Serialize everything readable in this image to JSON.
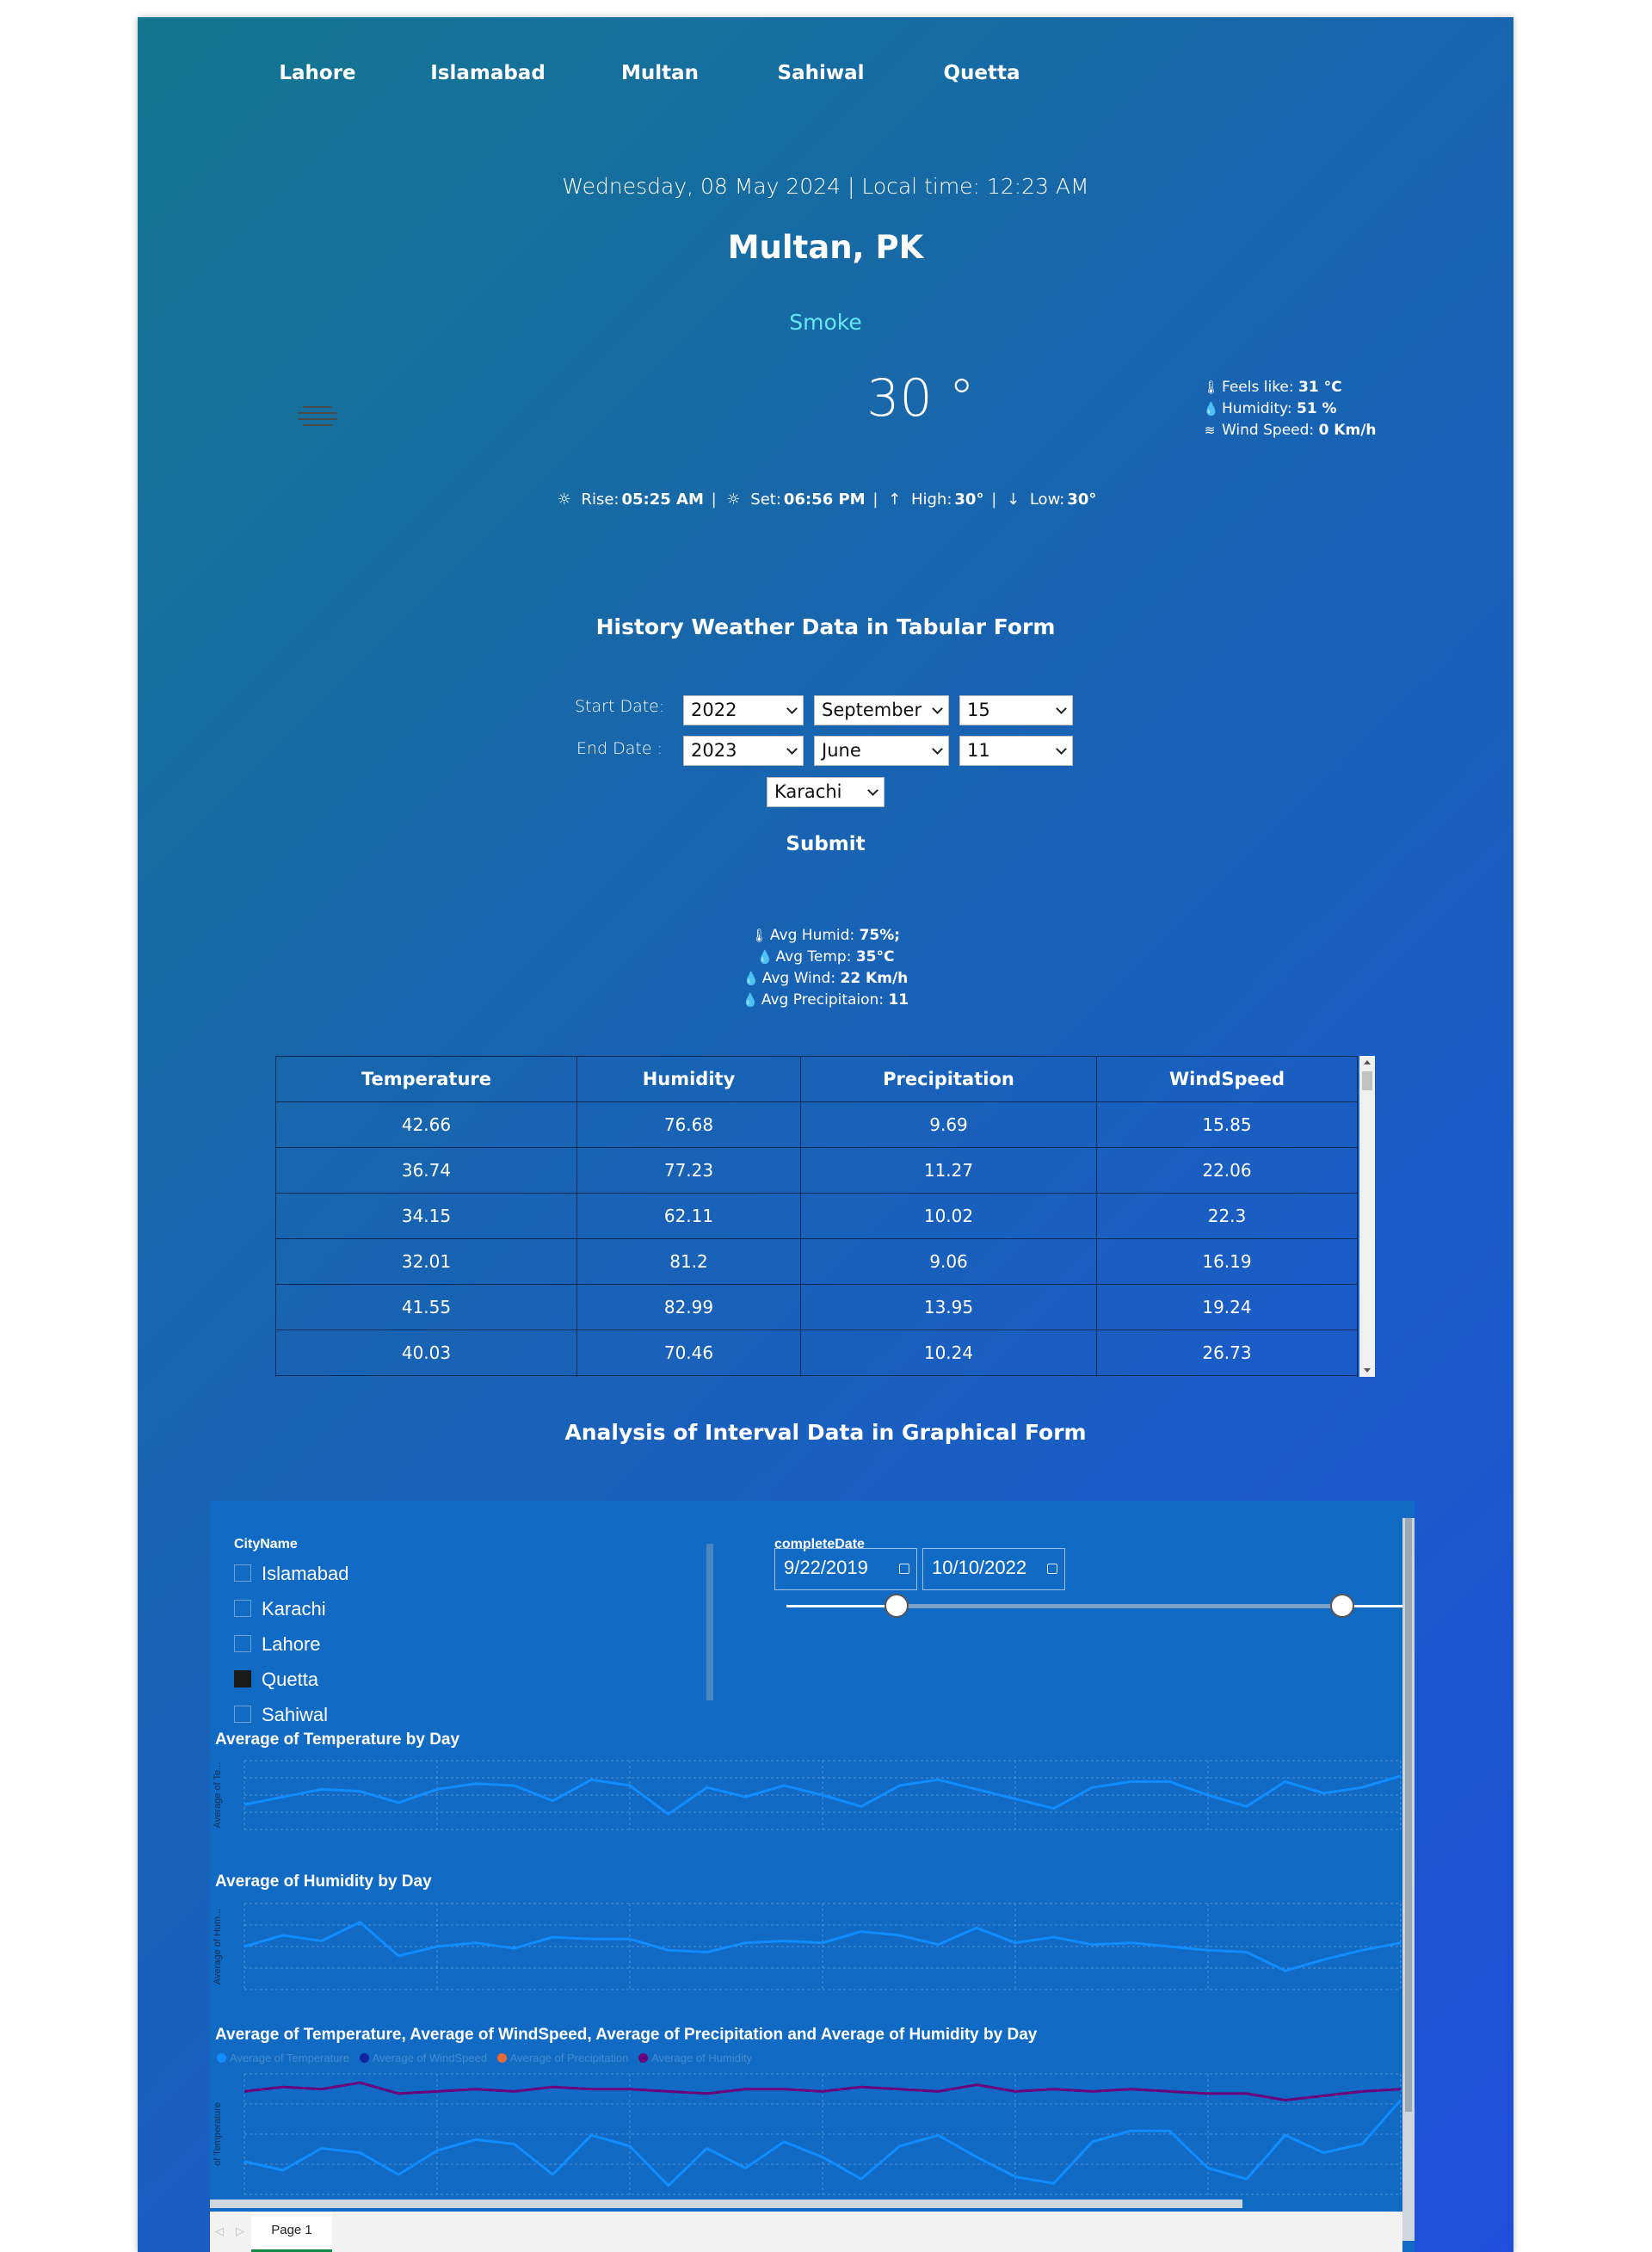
{
  "nav": [
    "Lahore",
    "Islamabad",
    "Multan",
    "Sahiwal",
    "Quetta"
  ],
  "current": {
    "date_line": "Wednesday, 08 May 2024 | Local time: 12:23 AM",
    "city": "Multan, PK",
    "condition": "Smoke",
    "temp": "30 °",
    "feels_label": "Feels like:",
    "feels_value": "31 °C",
    "humidity_label": "Humidity:",
    "humidity_value": "51 %",
    "wind_label": "Wind Speed:",
    "wind_value": "0 Km/h",
    "rise_label": "Rise:",
    "rise_value": "05:25 AM",
    "set_label": "Set:",
    "set_value": "06:56 PM",
    "high_label": "High:",
    "high_value": "30°",
    "low_label": "Low:",
    "low_value": "30°"
  },
  "history": {
    "title": "History Weather Data in Tabular Form",
    "start_label": "Start Date:",
    "end_label": "End Date :",
    "start": {
      "year": "2022",
      "month": "September",
      "day": "15"
    },
    "end": {
      "year": "2023",
      "month": "June",
      "day": "11"
    },
    "city": "Karachi",
    "submit": "Submit",
    "avg_humid_label": "Avg Humid:",
    "avg_humid_value": "75%;",
    "avg_temp_label": "Avg Temp:",
    "avg_temp_value": "35°C",
    "avg_wind_label": "Avg Wind:",
    "avg_wind_value": "22 Km/h",
    "avg_precip_label": "Avg Precipitaion:",
    "avg_precip_value": "11",
    "columns": [
      "Temperature",
      "Humidity",
      "Precipitation",
      "WindSpeed"
    ],
    "rows": [
      [
        "42.66",
        "76.68",
        "9.69",
        "15.85"
      ],
      [
        "36.74",
        "77.23",
        "11.27",
        "22.06"
      ],
      [
        "34.15",
        "62.11",
        "10.02",
        "22.3"
      ],
      [
        "32.01",
        "81.2",
        "9.06",
        "16.19"
      ],
      [
        "41.55",
        "82.99",
        "13.95",
        "19.24"
      ],
      [
        "40.03",
        "70.46",
        "10.24",
        "26.73"
      ]
    ]
  },
  "analysis": {
    "title": "Analysis of Interval Data in Graphical Form",
    "city_slicer_title": "CityName",
    "cities": [
      "Islamabad",
      "Karachi",
      "Lahore",
      "Quetta",
      "Sahiwal"
    ],
    "selected_city": "Quetta",
    "date_slicer_title": "completeDate",
    "date_from": "9/22/2019",
    "date_to": "10/10/2022",
    "page_tab": "Page 1"
  },
  "chart_data": [
    {
      "type": "line",
      "title": "Average of Temperature by Day",
      "ylabel": "Average of Te...",
      "series": [
        {
          "values": [
            30,
            32,
            34,
            33.5,
            30.5,
            34,
            35.5,
            35,
            31,
            36.5,
            35,
            27.5,
            34.5,
            32,
            35,
            32.5,
            29.5,
            35,
            36.5,
            34,
            31.5,
            29,
            34.5,
            36,
            36,
            32.5,
            29.5,
            36,
            33,
            34.5,
            37.5
          ]
        }
      ],
      "color": "#118dff"
    },
    {
      "type": "line",
      "title": "Average of Humidity by Day",
      "ylabel": "Average of Hum...",
      "series": [
        {
          "values": [
            62,
            68,
            65,
            75,
            57,
            62,
            64,
            61,
            67,
            66,
            66,
            60,
            59,
            64,
            65,
            64,
            70,
            68,
            63,
            72,
            64,
            67,
            63,
            64,
            62,
            60,
            59,
            49,
            55,
            60,
            64
          ]
        }
      ],
      "color": "#118dff"
    },
    {
      "type": "line",
      "title": "Average of Temperature, Average of WindSpeed, Average of Precipitation and Average of Humidity by Day",
      "legend": [
        "Average of Temperature",
        "Average of WindSpeed",
        "Average of Precipitation",
        "Average of Humidity"
      ],
      "ylabel": "of Temperature",
      "series": [
        {
          "name": "Average of Temperature",
          "color": "#118dff",
          "values": [
            26,
            22,
            32,
            30,
            20,
            31,
            36,
            34,
            20,
            38,
            33,
            15,
            32,
            23,
            35,
            28,
            18,
            33,
            38,
            28,
            19,
            16,
            35,
            40,
            40,
            23,
            18,
            38,
            30,
            34,
            54
          ]
        },
        {
          "name": "Average of Humidity",
          "color": "#6b007b",
          "values": [
            58,
            60,
            59,
            62,
            57,
            58,
            59,
            58,
            60,
            59,
            59,
            58,
            57,
            59,
            59,
            58,
            60,
            59,
            58,
            61,
            58,
            59,
            58,
            59,
            58,
            57,
            57,
            54,
            56,
            58,
            59
          ]
        }
      ]
    }
  ]
}
